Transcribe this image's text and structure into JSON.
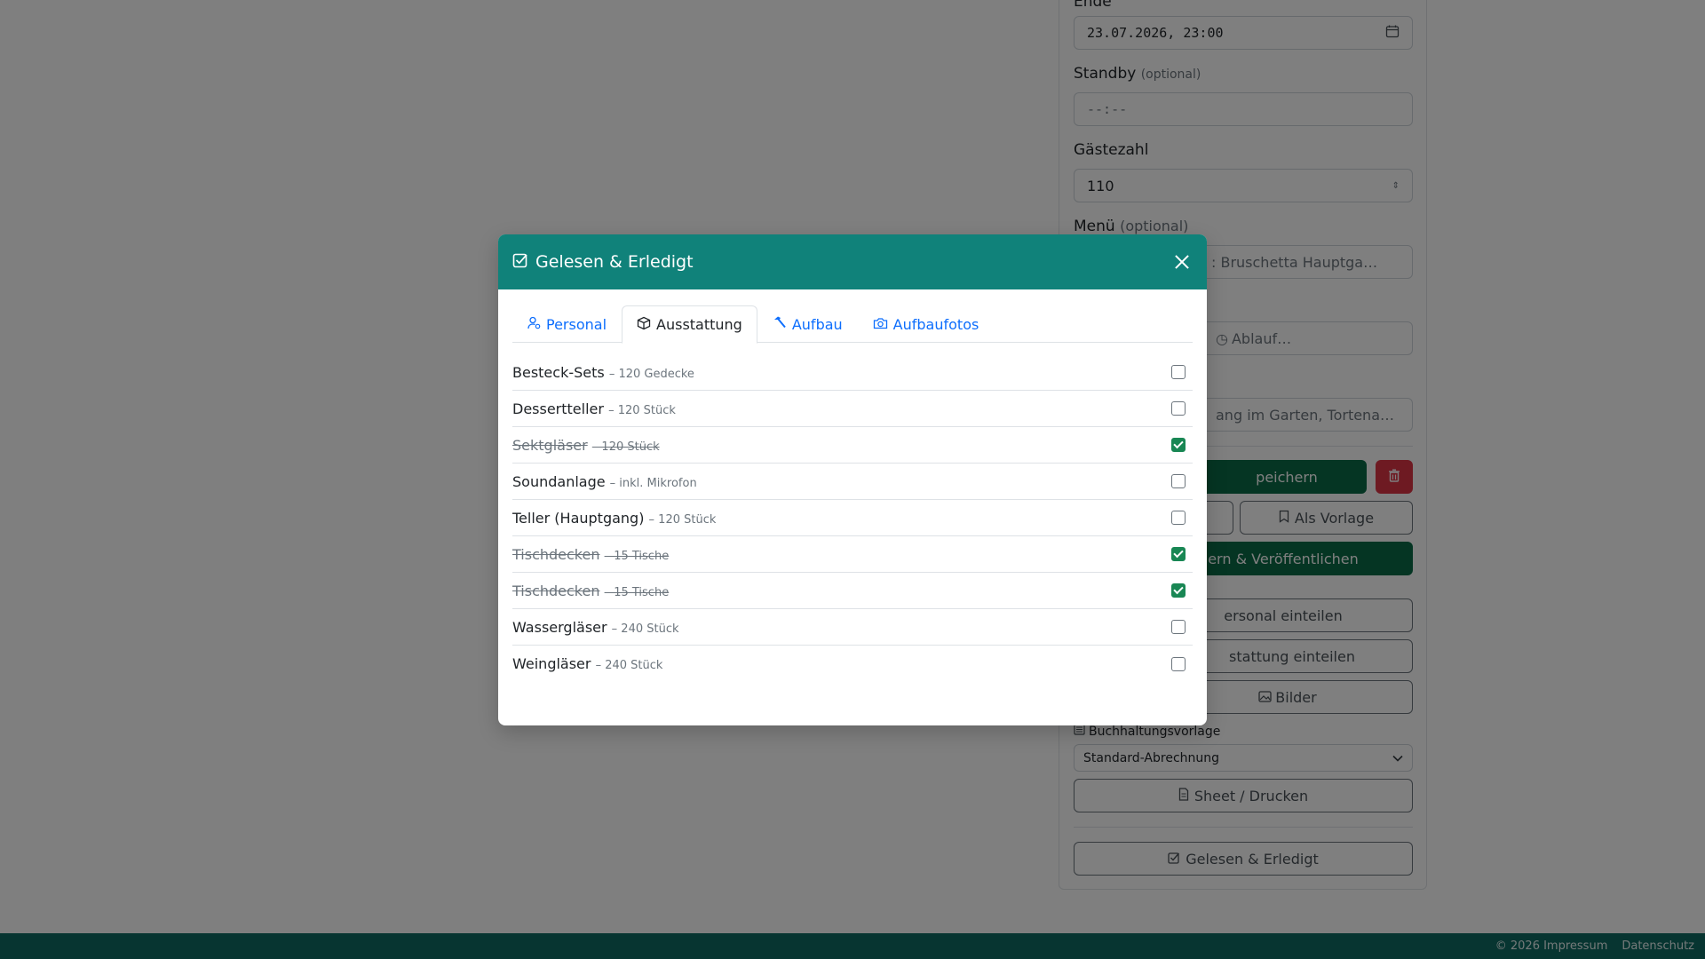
{
  "background": {
    "end_label": "Ende",
    "end_value": "23.07.2026, 23:00",
    "standby_label": "Standby",
    "standby_optional": "(optional)",
    "standby_value": "--:--",
    "guests_label": "Gästezahl",
    "guests_value": "110",
    "menu_label": "Menü",
    "menu_optional": "(optional)",
    "menu_value": ": Bruschetta Hauptga…",
    "ablauf_value": "Ablauf…",
    "notes_value": "ang im Garten, Tortena…",
    "save_label": "peichern",
    "template_label": "Als Vorlage",
    "publish_label": "ern & Veröffentlichen",
    "personal_label": "ersonal einteilen",
    "equipment_label": "stattung einteilen",
    "images_label": "Bilder",
    "accounting_label": "Buchhaltungsvorlage",
    "accounting_value": "Standard-Abrechnung",
    "sheet_label": "Sheet / Drucken",
    "read_done_label": "Gelesen & Erledigt"
  },
  "footer": {
    "copyright": "© 2026 Impressum",
    "privacy": "Datenschutz"
  },
  "modal": {
    "title": "Gelesen & Erledigt",
    "tabs": [
      {
        "label": "Personal",
        "icon": "person-gear-icon",
        "active": false
      },
      {
        "label": "Ausstattung",
        "icon": "box-icon",
        "active": true
      },
      {
        "label": "Aufbau",
        "icon": "hammer-icon",
        "active": false
      },
      {
        "label": "Aufbaufotos",
        "icon": "camera-icon",
        "active": false
      }
    ],
    "items": [
      {
        "name": "Besteck-Sets",
        "detail": "– 120 Gedecke",
        "checked": false
      },
      {
        "name": "Dessertteller",
        "detail": "– 120 Stück",
        "checked": false
      },
      {
        "name": "Sektgläser",
        "detail": "– 120 Stück",
        "checked": true
      },
      {
        "name": "Soundanlage",
        "detail": "– inkl. Mikrofon",
        "checked": false
      },
      {
        "name": "Teller (Hauptgang)",
        "detail": "– 120 Stück",
        "checked": false
      },
      {
        "name": "Tischdecken",
        "detail": "– 15 Tische",
        "checked": true
      },
      {
        "name": "Tischdecken",
        "detail": "– 15 Tische",
        "checked": true
      },
      {
        "name": "Wassergläser",
        "detail": "– 240 Stück",
        "checked": false
      },
      {
        "name": "Weingläser",
        "detail": "– 240 Stück",
        "checked": false
      }
    ]
  },
  "colors": {
    "header": "#10827a",
    "footer": "#0f6b63",
    "checked": "#198754",
    "tab_link": "#0d6efd"
  }
}
